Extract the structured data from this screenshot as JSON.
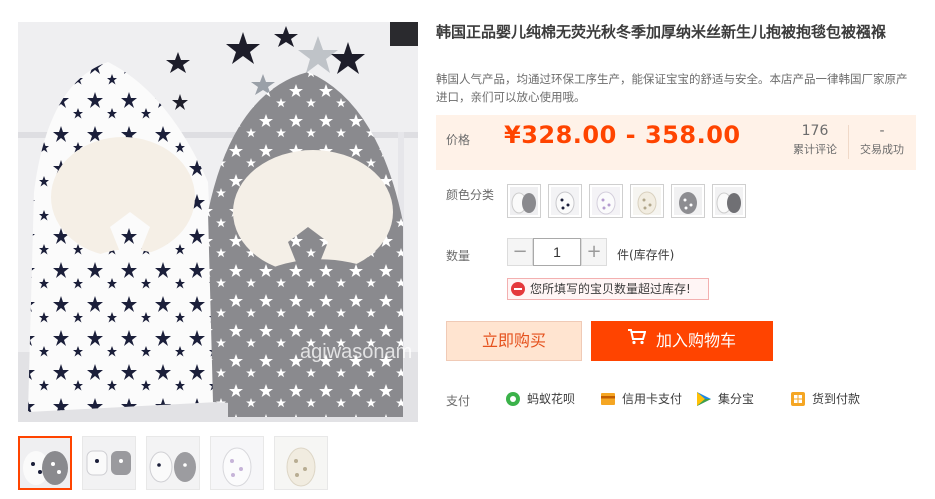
{
  "product": {
    "title": "韩国正品婴儿纯棉无荧光秋冬季加厚纳米丝新生儿抱被抱毯包被襁褓",
    "subtitle": "韩国人气产品，均通过环保工序生产，能保证宝宝的舒适与安全。本店产品一律韩国厂家原产进口，亲们可以放心使用哦。",
    "image_watermark": "agiwasonam"
  },
  "price": {
    "label": "价格",
    "value": "¥328.00 - 358.00",
    "review_count": "176",
    "review_label": "累计评论",
    "deals_count": "-",
    "deals_label": "交易成功"
  },
  "color": {
    "label": "颜色分类",
    "swatch_count": 6
  },
  "quantity": {
    "label": "数量",
    "value": "1",
    "minus": "−",
    "plus": "+",
    "unit": "件(库存件)"
  },
  "warning": {
    "text": "您所填写的宝贝数量超过库存!"
  },
  "actions": {
    "buy_now": "立即购买",
    "add_to_cart": "加入购物车"
  },
  "payment": {
    "label": "支付",
    "methods": [
      "蚂蚁花呗",
      "信用卡支付",
      "集分宝",
      "货到付款"
    ]
  },
  "colors": {
    "accent": "#ff4400",
    "price_bg": "#fff2e8",
    "buy_now_bg": "#ffe4d0",
    "warning_red": "#e4393c"
  }
}
